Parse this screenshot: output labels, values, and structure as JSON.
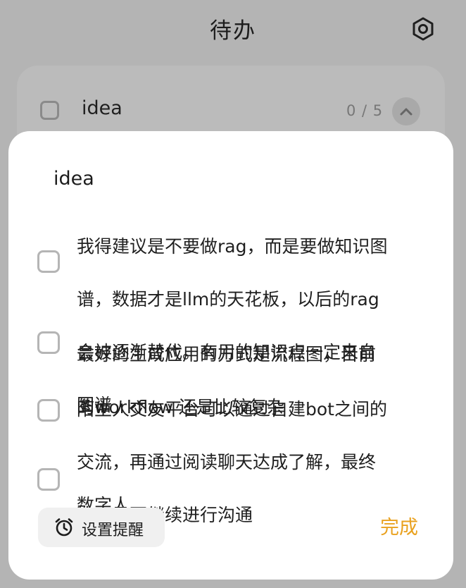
{
  "header": {
    "title": "待办",
    "settings_icon": "gear-icon"
  },
  "todo_group": {
    "title": "idea",
    "count": "0 / 5",
    "collapse_icon": "chevron-up-icon"
  },
  "sheet": {
    "title": "idea",
    "items": [
      {
        "text": "我得建议是不要做rag，而是要做知识图谱，数据才是llm的天花板，以后的rag会被逐渐替代。有用的知识点一定来自图谱",
        "lines": [
          "我得建议是不要做rag，而是要做知识图",
          "谱，数据才是llm的天花板，以后的rag",
          "会被逐渐替代。有用的知识点一定来自",
          "图谱"
        ],
        "checked": false
      },
      {
        "text": "最好的生成应用的方式是流程图，目前的workflow 还是比较复杂",
        "lines": [
          "最好的生成应用的方式是流程图，目前",
          "的workflow 还是比较复杂"
        ],
        "checked": false
      },
      {
        "text": "陌生人交友平台可以通过自建bot之间的交流，再通过阅读聊天达成了解，最终决定是否继续进行沟通",
        "lines": [
          "陌生人交友平台可以通过自建bot之间的",
          "交流，再通过阅读聊天达成了解，最终",
          "决定是否继续进行沟通"
        ],
        "checked": false
      },
      {
        "text": "数字人",
        "lines": [
          "数字人"
        ],
        "checked": false
      }
    ],
    "reminder_label": "设置提醒",
    "reminder_icon": "alarm-clock-icon",
    "done_label": "完成"
  },
  "colors": {
    "accent": "#e9a11e",
    "background": "#b4b4b4",
    "sheet": "#ffffff"
  }
}
